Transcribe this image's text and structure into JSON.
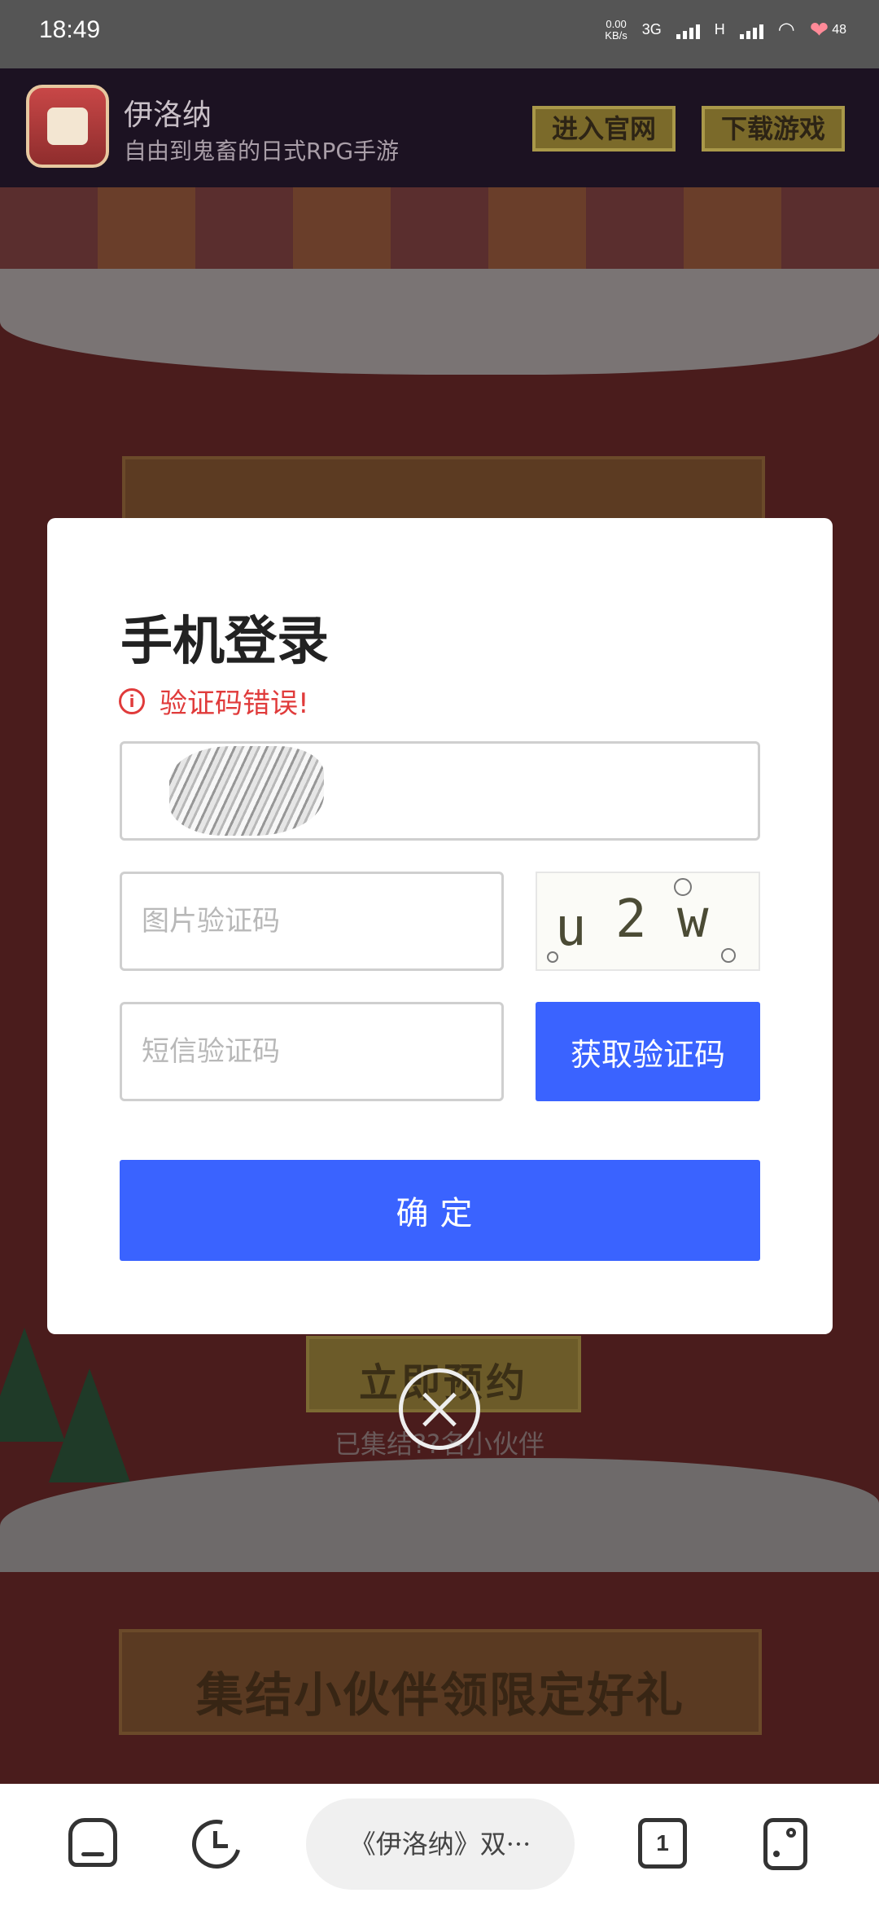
{
  "status_bar": {
    "time": "18:49",
    "net_speed_value": "0.00",
    "net_speed_unit": "KB/s",
    "network_1": "3G",
    "network_2": "H",
    "battery": "48"
  },
  "banner": {
    "app_name": "伊洛纳",
    "app_desc": "自由到鬼畜的日式RPG手游",
    "official_site_label": "进入官网",
    "download_label": "下载游戏"
  },
  "background": {
    "reserve_label": "立即预约",
    "gathered_text": "已集结??名小伙伴",
    "banner_text": "集结小伙伴领限定好礼"
  },
  "modal": {
    "title": "手机登录",
    "error_message": "验证码错误!",
    "phone_value": "",
    "captcha_placeholder": "图片验证码",
    "captcha_chars": [
      "u",
      "2",
      "w"
    ],
    "sms_placeholder": "短信验证码",
    "get_code_label": "获取验证码",
    "confirm_label": "确定"
  },
  "bottom_nav": {
    "url_title": "《伊洛纳》双···",
    "tab_count": "1"
  },
  "colors": {
    "primary_blue": "#3a63ff",
    "error_red": "#e03b3b"
  }
}
